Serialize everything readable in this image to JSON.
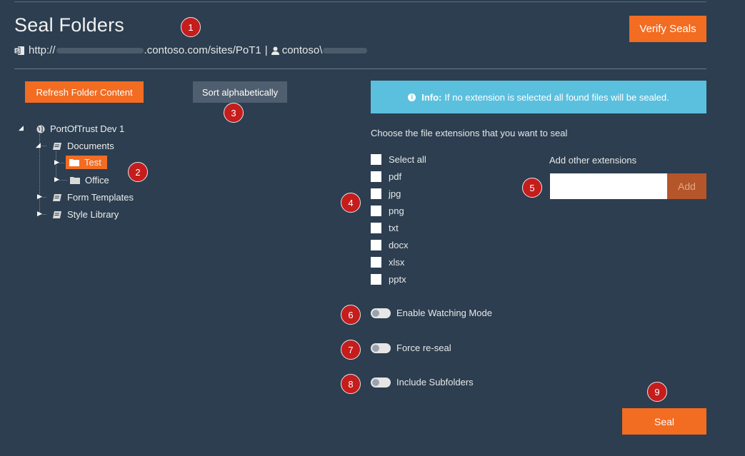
{
  "header": {
    "title": "Seal Folders",
    "url_prefix": "http://",
    "url_suffix": ".contoso.com/sites/PoT1",
    "separator": "|",
    "user_prefix": "contoso\\",
    "verify_label": "Verify Seals"
  },
  "toolbar": {
    "refresh_label": "Refresh Folder Content",
    "sort_label": "Sort alphabetically"
  },
  "tree": {
    "root": "PortOfTrust Dev 1",
    "documents": "Documents",
    "test": "Test",
    "office": "Office",
    "form_templates": "Form Templates",
    "style_library": "Style Library"
  },
  "info": {
    "bold": "Info:",
    "text": "If no extension is selected all found files will be sealed."
  },
  "extensions": {
    "prompt": "Choose the file extensions that you want to seal",
    "items": [
      "Select all",
      "pdf",
      "jpg",
      "png",
      "txt",
      "docx",
      "xlsx",
      "pptx"
    ],
    "add_label": "Add other extensions",
    "add_input_value": "",
    "add_button": "Add"
  },
  "toggles": {
    "watching": "Enable Watching Mode",
    "reseal": "Force re-seal",
    "subfolders": "Include Subfolders"
  },
  "seal_label": "Seal",
  "badges": [
    "1",
    "2",
    "3",
    "4",
    "5",
    "6",
    "7",
    "8",
    "9"
  ],
  "colors": {
    "background": "#2c3e50",
    "accent": "#f26c22",
    "info": "#5bc0de",
    "badge": "#c51c1c"
  }
}
